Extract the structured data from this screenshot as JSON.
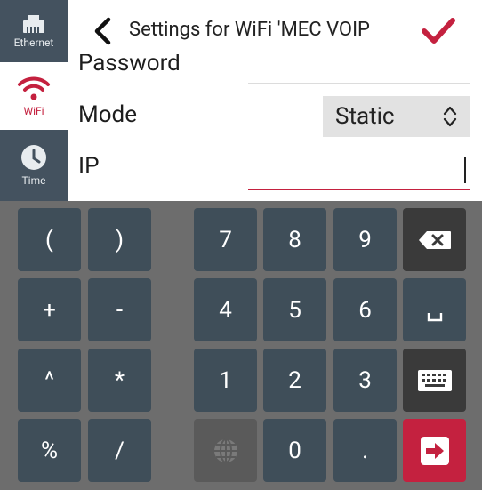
{
  "sidebar": {
    "items": [
      {
        "label": "Ethernet",
        "icon": "ethernet-icon"
      },
      {
        "label": "WiFi",
        "icon": "wifi-icon",
        "active": true
      },
      {
        "label": "Time",
        "icon": "clock-icon"
      }
    ]
  },
  "header": {
    "title": "Settings for WiFi 'MEC VOIP",
    "back_icon": "chevron-left-icon",
    "confirm_icon": "checkmark-icon"
  },
  "form": {
    "password_label": "Password",
    "mode_label": "Mode",
    "mode_value": "Static",
    "ip_label": "IP",
    "ip_value": ""
  },
  "keyboard": {
    "row1": [
      "(",
      ")",
      "7",
      "8",
      "9"
    ],
    "row2": [
      "+",
      "-",
      "4",
      "5",
      "6"
    ],
    "row3": [
      "^",
      "*",
      "1",
      "2",
      "3"
    ],
    "row4": [
      "%",
      "/",
      "0",
      "."
    ],
    "icons": {
      "backspace": "backspace-icon",
      "space": "space-icon",
      "keyboard": "keyboard-icon",
      "globe": "globe-icon",
      "enter": "enter-icon"
    }
  },
  "colors": {
    "accent": "#c4213f",
    "sidebar": "#44525f",
    "key": "#3f4e59",
    "keyboard_bg": "#6d6d6d",
    "select_bg": "#e2e2e2"
  }
}
